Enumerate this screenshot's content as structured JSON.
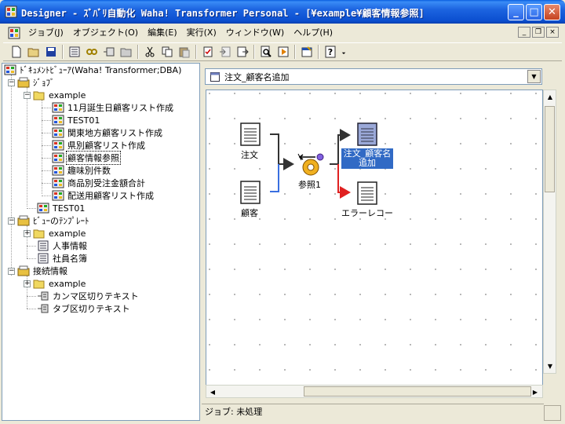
{
  "window": {
    "title": "Designer - ｽﾞﾊﾞﾘ自動化 Waha! Transformer Personal - [¥example¥顧客情報参照]",
    "minimize_label": "_",
    "maximize_label": "□",
    "close_label": "✕"
  },
  "menu": {
    "items": [
      "ジョブ(J)",
      "オブジェクト(O)",
      "編集(E)",
      "実行(X)",
      "ウィンドウ(W)",
      "ヘルプ(H)"
    ],
    "mdi_minimize": "_",
    "mdi_restore": "❐",
    "mdi_close": "×"
  },
  "tree": {
    "root": "ﾄﾞｷｭﾒﾝﾄﾋﾞｭｰｱ(Waha! Transformer;DBA)",
    "jobs_label": "ｼﾞｮﾌﾞ",
    "jobs_folder": "example",
    "jobs": [
      "11月誕生日顧客リスト作成",
      "TEST01",
      "関東地方顧客リスト作成",
      "県別顧客リスト作成",
      "顧客情報参照",
      "趣味別件数",
      "商品別受注金額合計",
      "配送用顧客リスト作成"
    ],
    "jobs_extra": "TEST01",
    "templates_label": "ﾋﾞｭｰのﾃﾝﾌﾟﾚｰﾄ",
    "templates_folder": "example",
    "templates": [
      "人事情報",
      "社員名簿"
    ],
    "connections_label": "接続情報",
    "connections_folder": "example",
    "connections": [
      "カンマ区切りテキスト",
      "タブ区切りテキスト"
    ],
    "expand_minus": "−",
    "expand_plus": "+"
  },
  "document_selector": {
    "value": "注文_顧客名追加",
    "arrow": "▼"
  },
  "diagram": {
    "nodes": {
      "order": "注文",
      "customer": "顧客",
      "lookup": "参照1",
      "output_line1": "注文_顧客名",
      "output_line2": "追加",
      "error": "エラーレコード"
    }
  },
  "scroll": {
    "up": "▲",
    "down": "▼",
    "left": "◀",
    "right": "▶"
  },
  "status": {
    "text": "ジョブ: 未処理"
  },
  "colors": {
    "titlebar": "#0b4fd0",
    "selection": "#316ac5",
    "link_blue": "#3a6fe0",
    "link_red": "#e02020",
    "link_dark": "#333333"
  }
}
